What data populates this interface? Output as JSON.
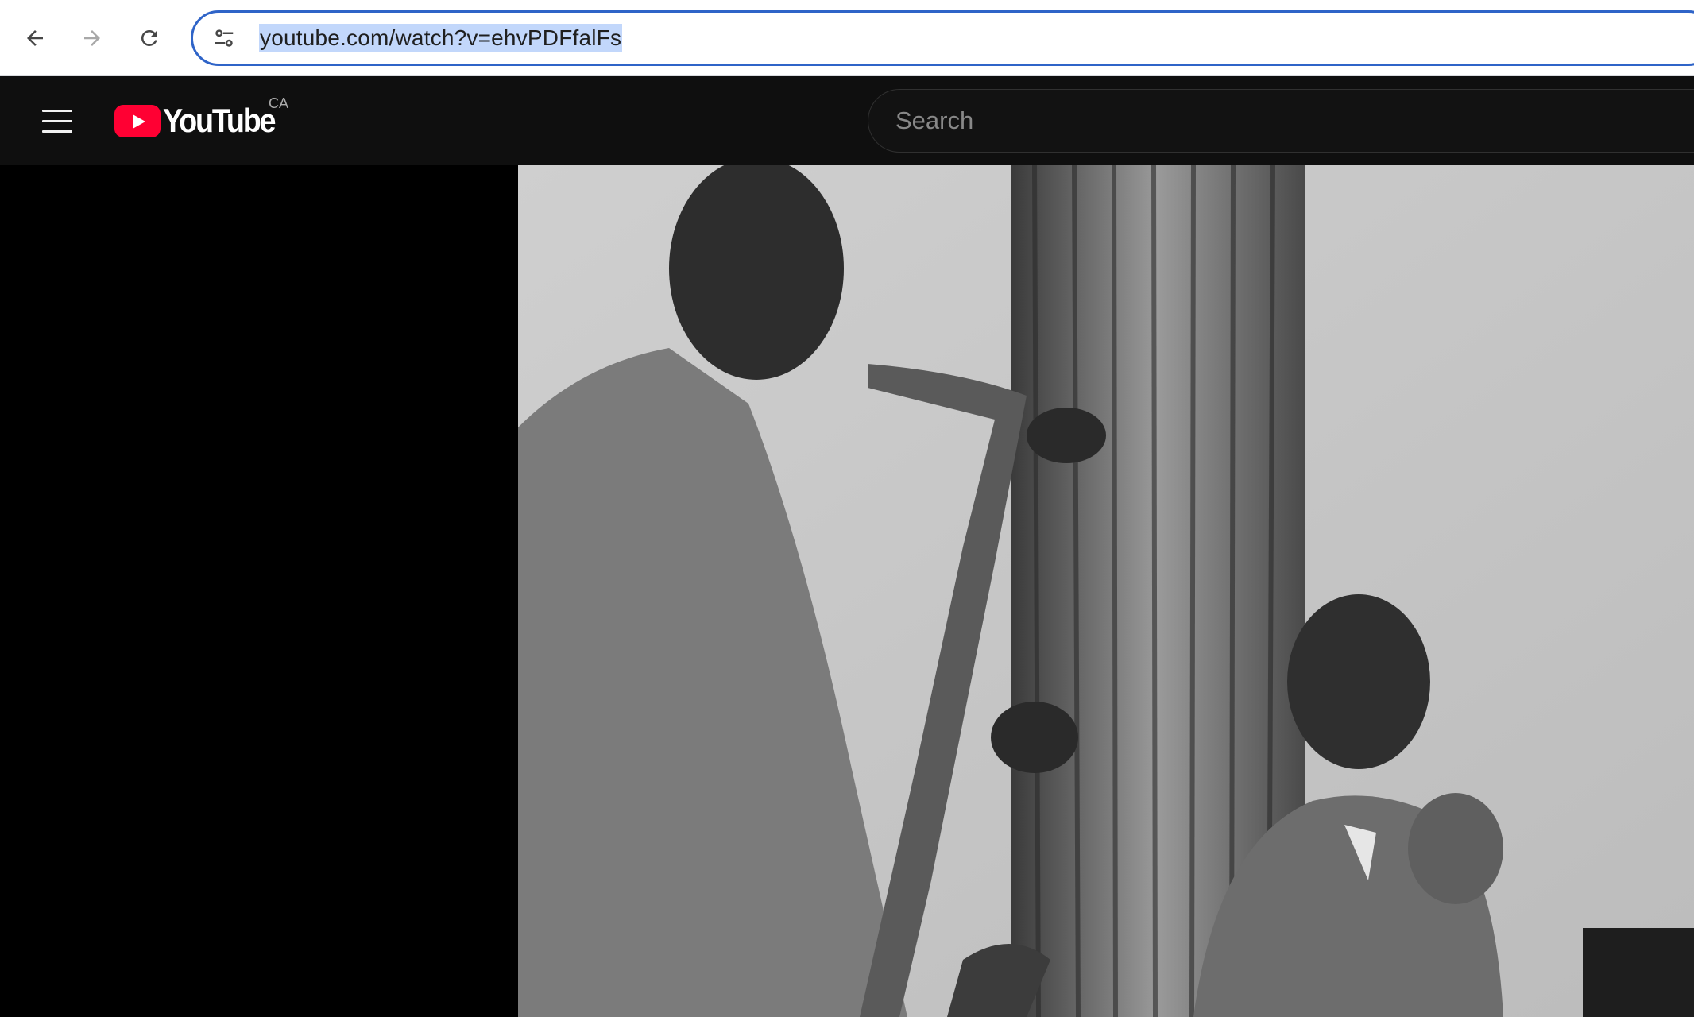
{
  "browser": {
    "url": "youtube.com/watch?v=ehvPDFfalFs",
    "back_icon": "arrow-left-icon",
    "forward_icon": "arrow-right-icon",
    "reload_icon": "reload-icon",
    "site_info_icon": "tune-icon"
  },
  "masthead": {
    "logo_text": "YouTube",
    "country_code": "CA",
    "search_placeholder": "Search",
    "menu_icon": "hamburger-menu-icon"
  },
  "video": {
    "description_icon": "video-frame"
  },
  "colors": {
    "omnibox_border": "#2f64c8",
    "url_selection": "#c2d7fb",
    "youtube_red": "#ff0033",
    "masthead_bg": "#0f0f0f"
  }
}
